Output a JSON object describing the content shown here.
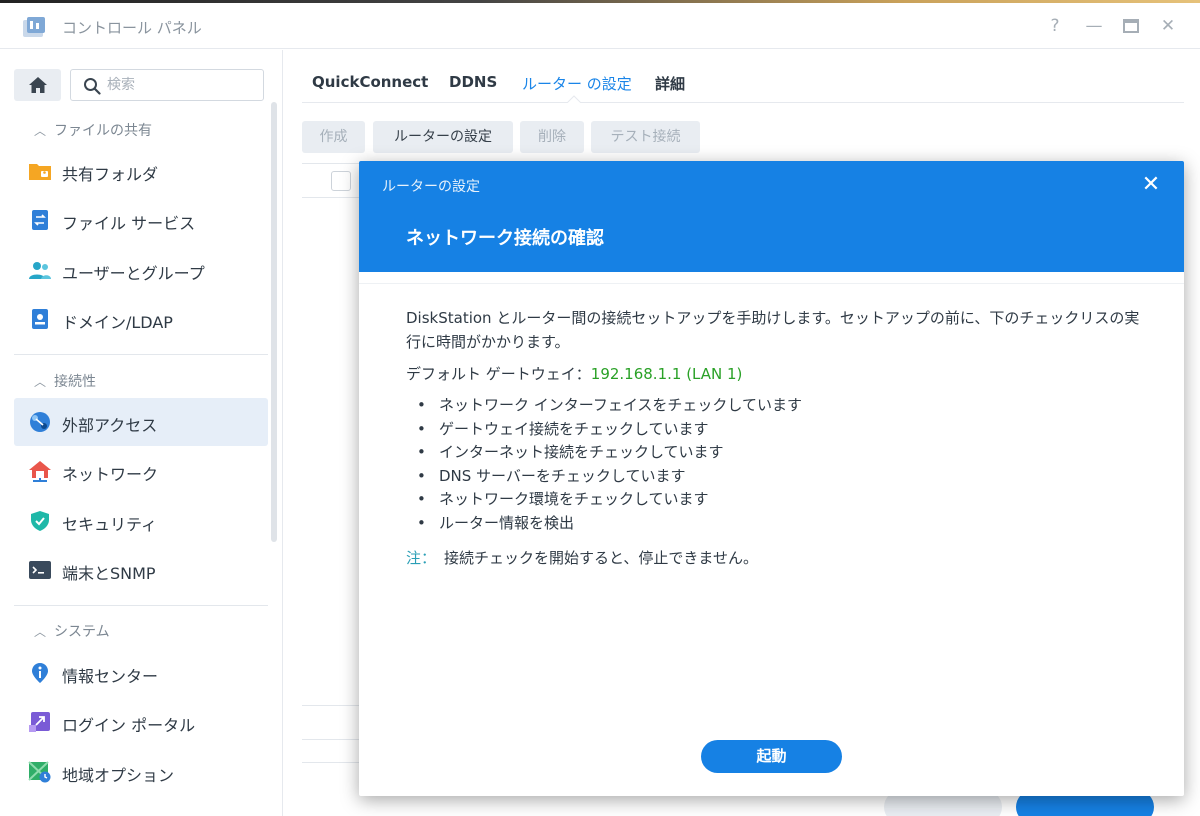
{
  "window": {
    "title": "コントロール パネル",
    "controls": {
      "help": "?",
      "minimize": "—",
      "maximize": "▭",
      "close": "✕"
    }
  },
  "sidebar": {
    "search_placeholder": "検索",
    "sections": [
      {
        "label": "ファイルの共有",
        "items": [
          "共有フォルダ",
          "ファイル サービス",
          "ユーザーとグループ",
          "ドメイン/LDAP"
        ]
      },
      {
        "label": "接続性",
        "items": [
          "外部アクセス",
          "ネットワーク",
          "セキュリティ",
          "端末とSNMP"
        ]
      },
      {
        "label": "システム",
        "items": [
          "情報センター",
          "ログイン ポータル",
          "地域オプション"
        ]
      }
    ],
    "active_item": "外部アクセス"
  },
  "main": {
    "tabs": [
      "QuickConnect",
      "DDNS",
      "ルーター の設定",
      "詳細"
    ],
    "active_tab": "ルーター の設定",
    "toolbar": [
      "作成",
      "ルーターの設定",
      "削除",
      "テスト接続"
    ]
  },
  "modal": {
    "title": "ルーターの設定",
    "heading": "ネットワーク接続の確認",
    "description": "DiskStation とルーター間の接続セットアップを手助けします。セットアップの前に、下のチェックリスの実行に時間がかかります。",
    "gateway_label": "デフォルト ゲートウェイ：",
    "gateway_value": "192.168.1.1 (LAN 1)",
    "checklist": [
      "ネットワーク インターフェイスをチェックしています",
      "ゲートウェイ接続をチェックしています",
      "インターネット接続をチェックしています",
      "DNS サーバーをチェックしています",
      "ネットワーク環境をチェックしています",
      "ルーター情報を検出"
    ],
    "note_label": "注：",
    "note_text": "接続チェックを開始すると、停止できません。",
    "start_button": "起動",
    "close": "✕"
  },
  "colors": {
    "accent": "#1681e4",
    "gateway_value": "#2aa127",
    "note_label": "#2a9fb6",
    "active_nav_bg": "#e6eef8"
  }
}
